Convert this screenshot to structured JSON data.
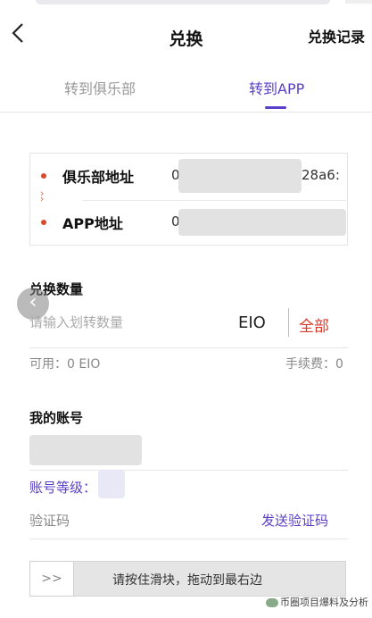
{
  "header": {
    "title": "兑换",
    "record_label": "兑换记录"
  },
  "tabs": [
    {
      "label": "转到俱乐部"
    },
    {
      "label": "转到APP"
    }
  ],
  "address": {
    "club_label": "俱乐部地址",
    "club_value_start": "0",
    "club_value_end": "28a6:",
    "app_label": "APP地址",
    "app_value_start": "0"
  },
  "amount": {
    "section_title": "兑换数量",
    "placeholder": "请输入划转数量",
    "unit": "EIO",
    "all_label": "全部",
    "available": "可用：0 EIO",
    "fee": "手续费：0"
  },
  "account": {
    "section_title": "我的账号",
    "level_label": "账号等级："
  },
  "verify": {
    "label": "验证码",
    "send_label": "发送验证码"
  },
  "slider": {
    "handle_text": ">>",
    "hint": "请按住滑块，拖动到最右边"
  },
  "watermark": {
    "text": "币圈项目爆料及分析"
  },
  "colors": {
    "accent": "#5a3fc8",
    "alert": "#d83a2a"
  }
}
